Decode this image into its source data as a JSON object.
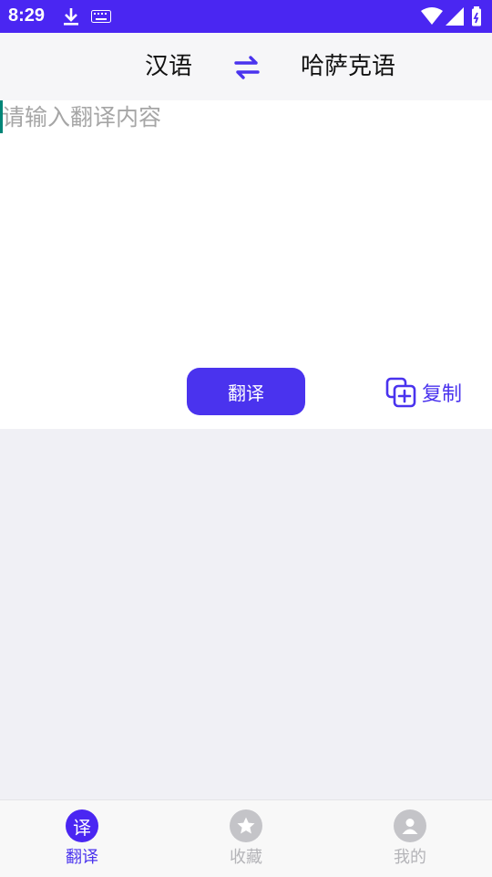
{
  "status_bar": {
    "time": "8:29"
  },
  "lang_bar": {
    "source": "汉语",
    "target": "哈萨克语"
  },
  "input": {
    "placeholder": "请输入翻译内容",
    "value": ""
  },
  "actions": {
    "translate_label": "翻译",
    "copy_label": "复制"
  },
  "tabs": [
    {
      "label": "翻译",
      "icon_char": "译",
      "active": true
    },
    {
      "label": "收藏",
      "active": false
    },
    {
      "label": "我的",
      "active": false
    }
  ],
  "colors": {
    "accent": "#4a33ee",
    "status_bar": "#4a26f2",
    "inactive": "#c4c4c8",
    "background": "#f0f0f5"
  }
}
